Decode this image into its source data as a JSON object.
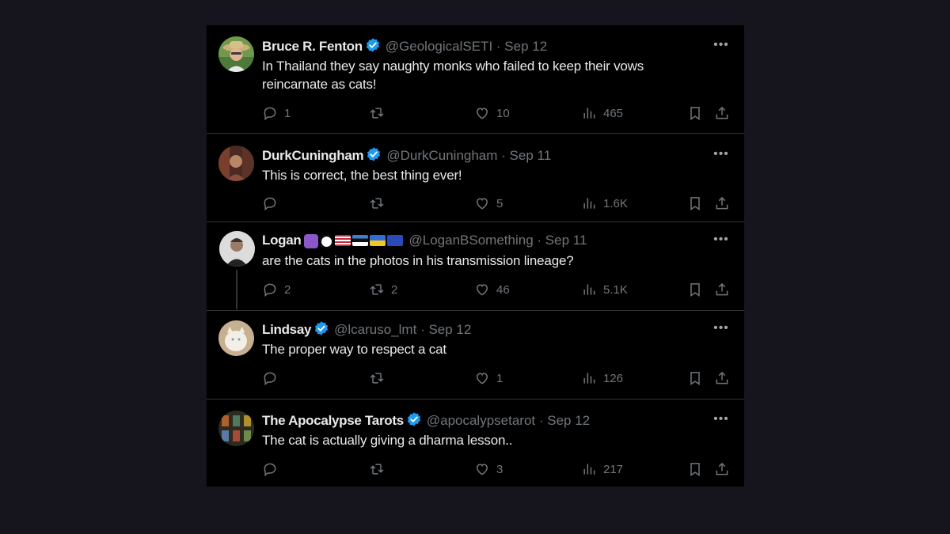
{
  "colors": {
    "background": "#16141c",
    "feed": "#000000",
    "text": "#e7e9ea",
    "muted": "#71767b",
    "verified": "#1d9bf0",
    "divider": "#2f3336"
  },
  "icons": {
    "reply": "reply-icon",
    "retweet": "retweet-icon",
    "like": "heart-icon",
    "views": "views-icon",
    "bookmark": "bookmark-icon",
    "share": "share-icon",
    "more": "more-icon"
  },
  "more_label": "•••",
  "tweets": [
    {
      "name": "Bruce R. Fenton",
      "handle": "@GeologicalSETI",
      "time": "· Sep 12",
      "verified": true,
      "text_lines": [
        "In Thailand they say naughty monks who failed to keep their vows",
        "reincarnate as cats!"
      ],
      "replies": "1",
      "retweets": "",
      "likes": "10",
      "views": "465"
    },
    {
      "name": "DurkCuningham",
      "handle": "@DurkCuningham",
      "time": "· Sep 11",
      "verified": true,
      "text_lines": [
        "This is correct, the best thing ever!"
      ],
      "replies": "",
      "retweets": "",
      "likes": "5",
      "views": "1.6K"
    },
    {
      "name": "Logan",
      "handle": "@LoganBSomething",
      "time": "· Sep 11",
      "verified": false,
      "flags": [
        "atom-emoji",
        "v-emoji",
        "us-flag",
        "estonia-flag",
        "ukraine-flag",
        "eu-flag"
      ],
      "text_lines": [
        "are the cats in the photos in his transmission lineage?"
      ],
      "replies": "2",
      "retweets": "2",
      "likes": "46",
      "views": "5.1K"
    },
    {
      "name": "Lindsay",
      "handle": "@lcaruso_lmt",
      "time": "· Sep 12",
      "verified": true,
      "text_lines": [
        "The proper way to respect a cat"
      ],
      "replies": "",
      "retweets": "",
      "likes": "1",
      "views": "126"
    },
    {
      "name": "The Apocalypse Tarots",
      "handle": "@apocalypsetarot",
      "time": "· Sep 12",
      "verified": true,
      "text_lines": [
        "The cat is actually giving a dharma lesson.."
      ],
      "replies": "",
      "retweets": "",
      "likes": "3",
      "views": "217"
    }
  ]
}
